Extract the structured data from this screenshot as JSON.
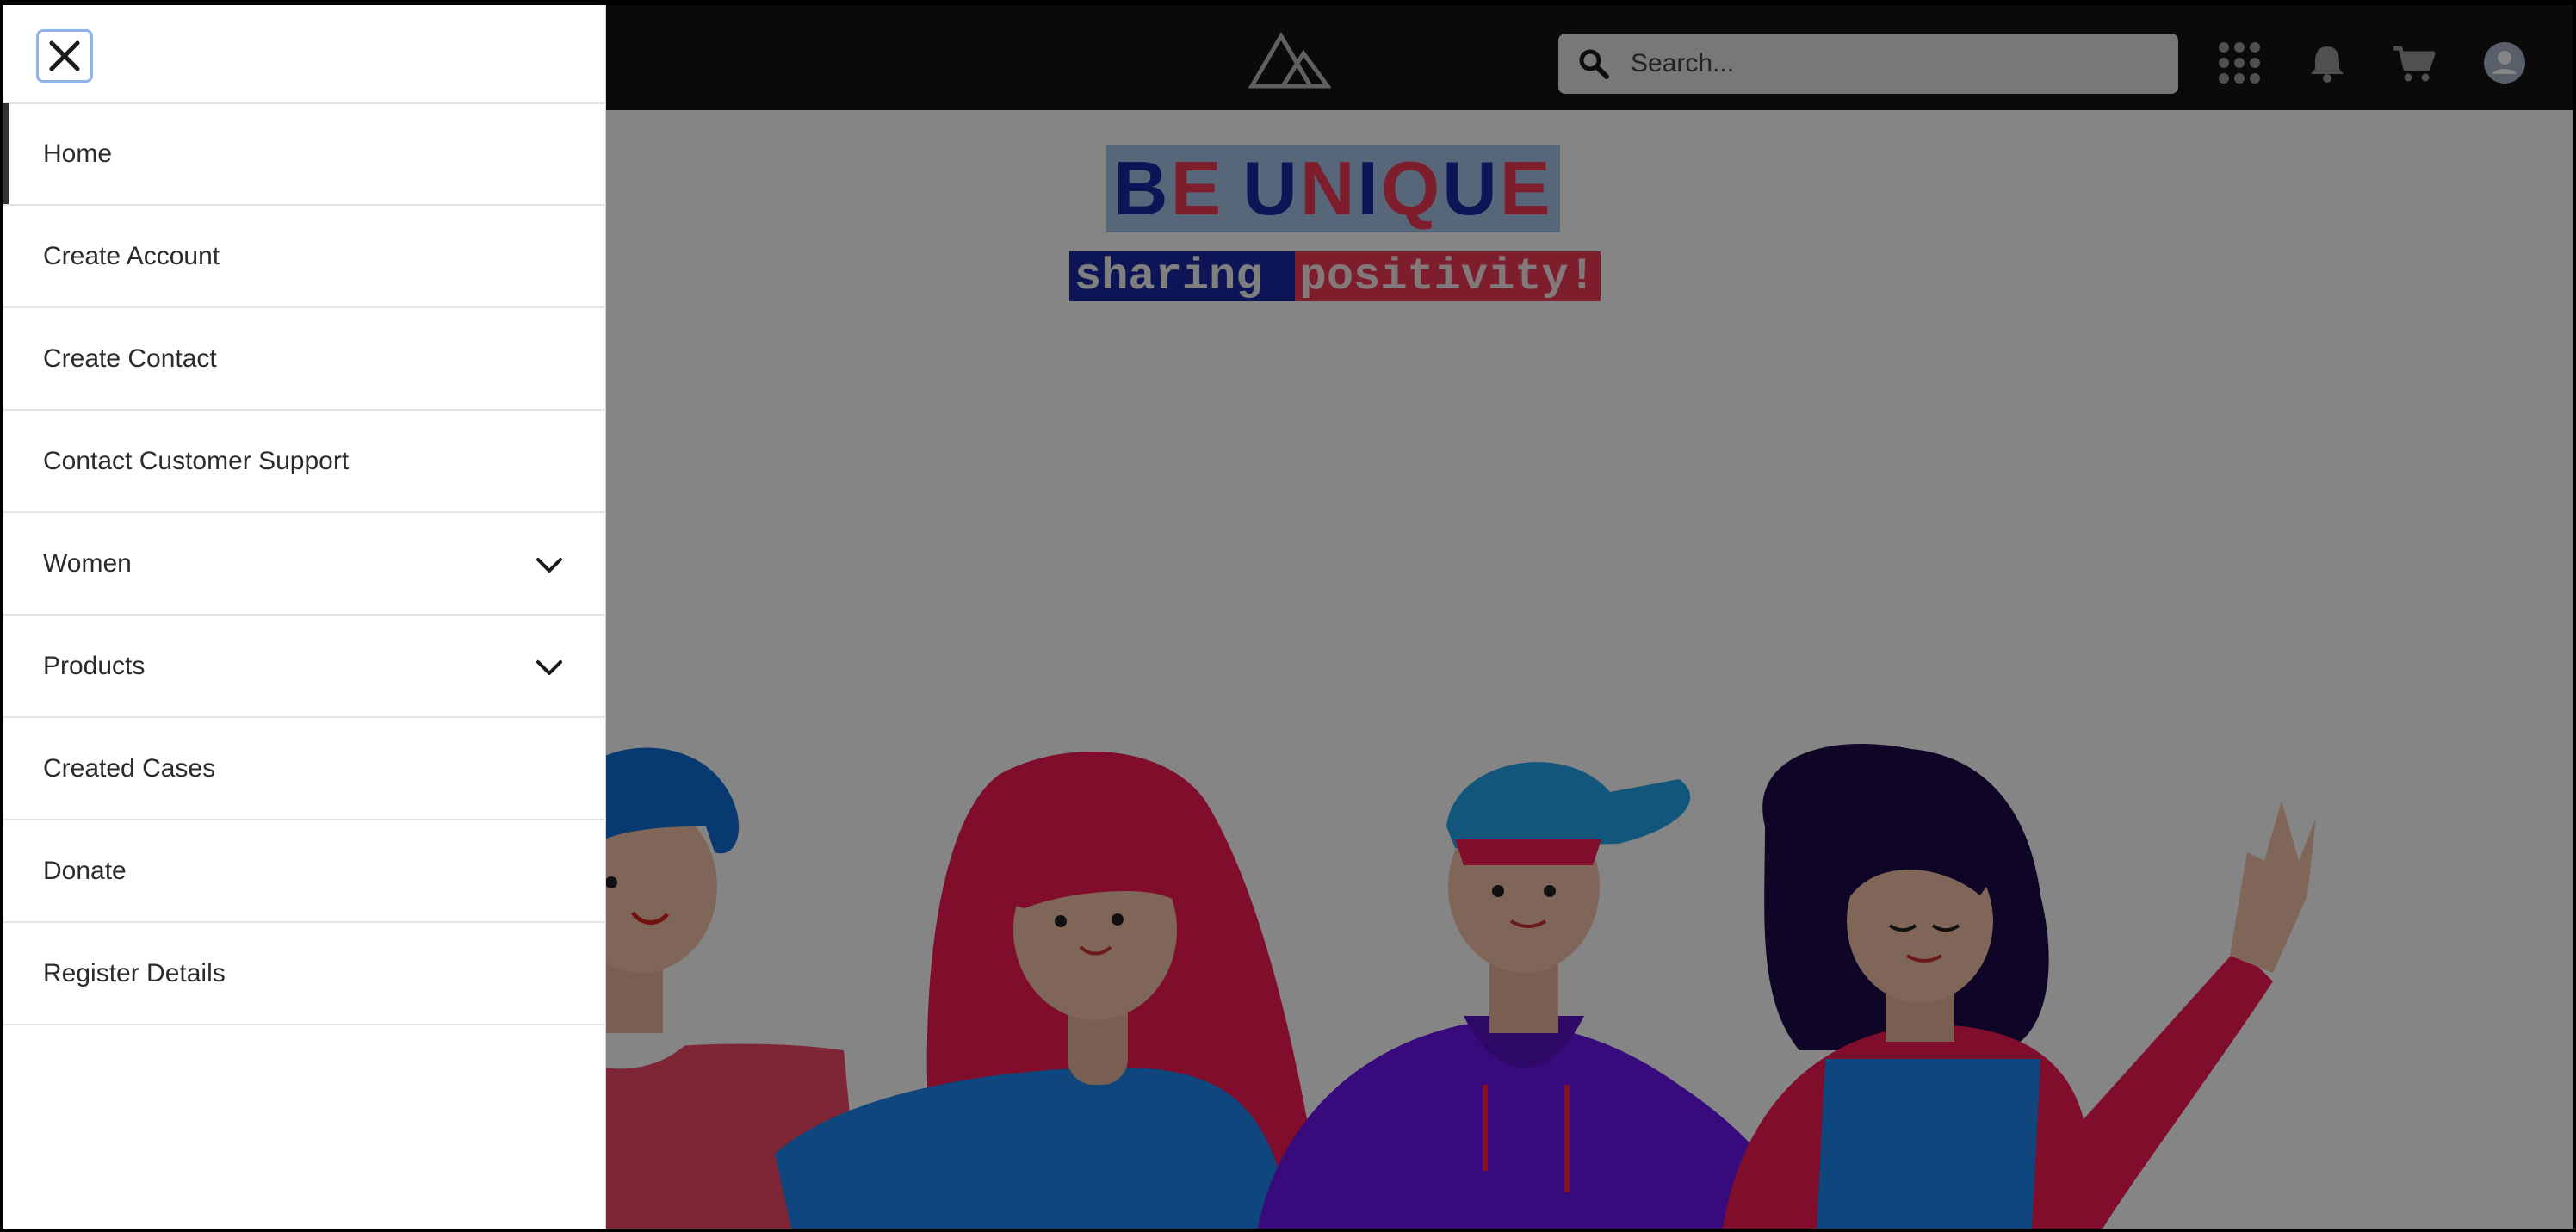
{
  "header": {
    "search_placeholder": "Search...",
    "icons": [
      "logo-mountain-icon",
      "search-icon",
      "app-launcher-icon",
      "bell-icon",
      "cart-icon",
      "user-avatar-icon"
    ]
  },
  "hero": {
    "title_letters": [
      "B",
      "E",
      " ",
      "U",
      "N",
      "I",
      "Q",
      "U",
      "E"
    ],
    "tagline_part1": "sharing ",
    "tagline_part2": "positivity!",
    "colors": {
      "blue": "#1c2aa8",
      "red": "#f23a57",
      "highlight": "#a9c4ea"
    }
  },
  "drawer": {
    "close_icon": "close-icon",
    "items": [
      {
        "label": "Home",
        "active": true,
        "has_submenu": false
      },
      {
        "label": "Create Account",
        "active": false,
        "has_submenu": false
      },
      {
        "label": "Create Contact",
        "active": false,
        "has_submenu": false
      },
      {
        "label": "Contact Customer Support",
        "active": false,
        "has_submenu": false
      },
      {
        "label": "Women",
        "active": false,
        "has_submenu": true
      },
      {
        "label": "Products",
        "active": false,
        "has_submenu": true
      },
      {
        "label": "Created Cases",
        "active": false,
        "has_submenu": false
      },
      {
        "label": "Donate",
        "active": false,
        "has_submenu": false
      },
      {
        "label": "Register Details",
        "active": false,
        "has_submenu": false
      }
    ]
  }
}
